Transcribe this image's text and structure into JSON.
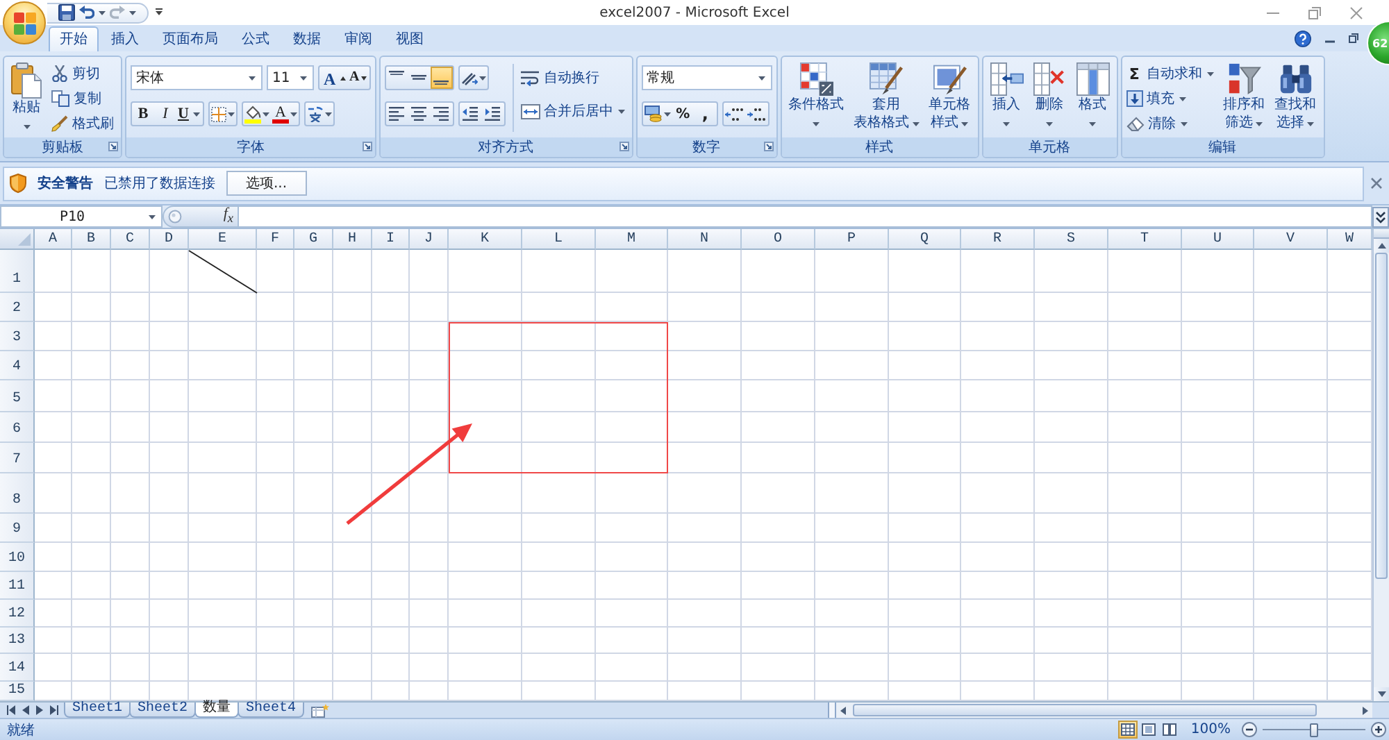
{
  "window": {
    "title": "excel2007 - Microsoft Excel"
  },
  "tabs": [
    {
      "label": "开始",
      "selected": true
    },
    {
      "label": "插入",
      "selected": false
    },
    {
      "label": "页面布局",
      "selected": false
    },
    {
      "label": "公式",
      "selected": false
    },
    {
      "label": "数据",
      "selected": false
    },
    {
      "label": "审阅",
      "selected": false
    },
    {
      "label": "视图",
      "selected": false
    }
  ],
  "floating_badge": {
    "text": "62"
  },
  "ribbon": {
    "clipboard": {
      "label": "剪贴板",
      "paste": "粘贴",
      "cut": "剪切",
      "copy": "复制",
      "format_painter": "格式刷"
    },
    "font": {
      "label": "字体",
      "font_name": "宋体",
      "font_size": "11",
      "grow_font": "A",
      "shrink_font": "A",
      "bold": "B",
      "italic": "I",
      "underline": "U",
      "font_color": "A"
    },
    "alignment": {
      "label": "对齐方式",
      "vertical": [
        {
          "kind": "top",
          "selected": false
        },
        {
          "kind": "middle",
          "selected": false
        },
        {
          "kind": "bottom",
          "selected": true
        }
      ],
      "horizontal": [
        {
          "kind": "left",
          "selected": false
        },
        {
          "kind": "center",
          "selected": false
        },
        {
          "kind": "right",
          "selected": false
        }
      ],
      "wrap_text": "自动换行",
      "merge_center": "合并后居中"
    },
    "number": {
      "label": "数字",
      "format": "常规",
      "percent": "%",
      "comma": ","
    },
    "styles": {
      "label": "样式",
      "buttons": [
        {
          "kind": "conditional",
          "lines": [
            "条件格式"
          ]
        },
        {
          "kind": "table",
          "lines": [
            "套用",
            "表格格式"
          ]
        },
        {
          "kind": "cell",
          "lines": [
            "单元格",
            "样式"
          ]
        }
      ]
    },
    "cells": {
      "label": "单元格",
      "buttons": [
        {
          "kind": "insert",
          "lines": [
            "插入"
          ]
        },
        {
          "kind": "delete",
          "lines": [
            "删除"
          ]
        },
        {
          "kind": "format",
          "lines": [
            "格式"
          ]
        }
      ]
    },
    "editing": {
      "label": "编辑",
      "small": [
        {
          "kind": "sum",
          "symbol": "Σ",
          "label": "自动求和"
        },
        {
          "kind": "fill",
          "label": "填充"
        },
        {
          "kind": "clear",
          "label": "清除"
        }
      ],
      "buttons": [
        {
          "kind": "sort",
          "lines": [
            "排序和",
            "筛选"
          ]
        },
        {
          "kind": "find",
          "lines": [
            "查找和",
            "选择"
          ]
        }
      ]
    }
  },
  "security_bar": {
    "title": "安全警告",
    "message": "已禁用了数据连接",
    "button": "选项..."
  },
  "formula_bar": {
    "name_box": "P10",
    "function_label": "f$_{x}$"
  },
  "columns": [
    "A",
    "B",
    "C",
    "D",
    "E",
    "F",
    "G",
    "H",
    "I",
    "J",
    "K",
    "L",
    "M",
    "N",
    "O",
    "P",
    "Q",
    "R",
    "S",
    "T",
    "U",
    "V",
    "W"
  ],
  "rows": [
    "1",
    "2",
    "3",
    "4",
    "5",
    "6",
    "7",
    "8",
    "9",
    "10",
    "11",
    "12",
    "13",
    "14",
    "15"
  ],
  "sheet_tabs": [
    {
      "label": "Sheet1",
      "selected": false
    },
    {
      "label": "Sheet2",
      "selected": false
    },
    {
      "label": "数量",
      "selected": true
    },
    {
      "label": "Sheet4",
      "selected": false
    }
  ],
  "status_bar": {
    "text": "就绪",
    "views": [
      {
        "kind": "normal",
        "selected": true
      },
      {
        "kind": "page_layout",
        "selected": false
      },
      {
        "kind": "page_break",
        "selected": false
      }
    ],
    "zoom": "100%",
    "zoom_slider": {
      "level": 0.5
    }
  }
}
